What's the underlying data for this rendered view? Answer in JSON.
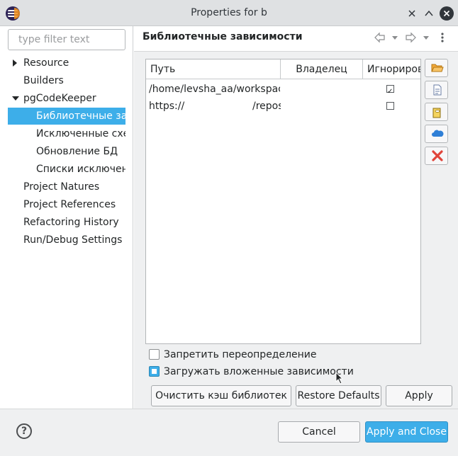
{
  "window": {
    "title": "Properties for b",
    "minimize_glyph": "✕",
    "maximize_glyph": "^",
    "close_glyph": "✕"
  },
  "filter": {
    "placeholder": "type filter text"
  },
  "tree": {
    "items": [
      {
        "label": "Resource",
        "expander": "collapsed"
      },
      {
        "label": "Builders"
      },
      {
        "label": "pgCodeKeeper",
        "expander": "expanded"
      },
      {
        "label": "Библиотечные зависимости",
        "selected": true
      },
      {
        "label": "Исключенные схемы"
      },
      {
        "label": "Обновление БД"
      },
      {
        "label": "Списки исключений"
      },
      {
        "label": "Project Natures"
      },
      {
        "label": "Project References"
      },
      {
        "label": "Refactoring History"
      },
      {
        "label": "Run/Debug Settings"
      }
    ]
  },
  "page": {
    "title": "Библиотечные зависимости",
    "nav_icons": [
      "back-arrow-icon",
      "back-dropdown-icon",
      "forward-arrow-icon",
      "forward-dropdown-icon",
      "view-menu-icon"
    ]
  },
  "table": {
    "columns": [
      "Путь",
      "Владелец",
      "Игнорировать"
    ],
    "rows": [
      {
        "path": "/home/levsha_aa/workspace/d",
        "owner": "",
        "ignore": true
      },
      {
        "path_start": "https://",
        "path_end": "/repos",
        "owner": "",
        "ignore": false
      }
    ]
  },
  "side_buttons": [
    "open-folder-icon",
    "add-file-icon",
    "add-database-icon",
    "add-remote-icon",
    "delete-icon"
  ],
  "options": {
    "forbid_override": {
      "label": "Запретить переопределение",
      "checked": false
    },
    "load_nested": {
      "label": "Загружать вложенные зависимости",
      "checked": true
    }
  },
  "buttons": {
    "clear_cache": "Очистить кэш библиотек",
    "restore_defaults": "Restore Defaults",
    "apply": "Apply",
    "cancel": "Cancel",
    "apply_close": "Apply and Close"
  },
  "help": {
    "glyph": "?"
  },
  "colors": {
    "accent": "#3daee9",
    "delete": "#e0443a",
    "folder": "#f2a93b"
  }
}
